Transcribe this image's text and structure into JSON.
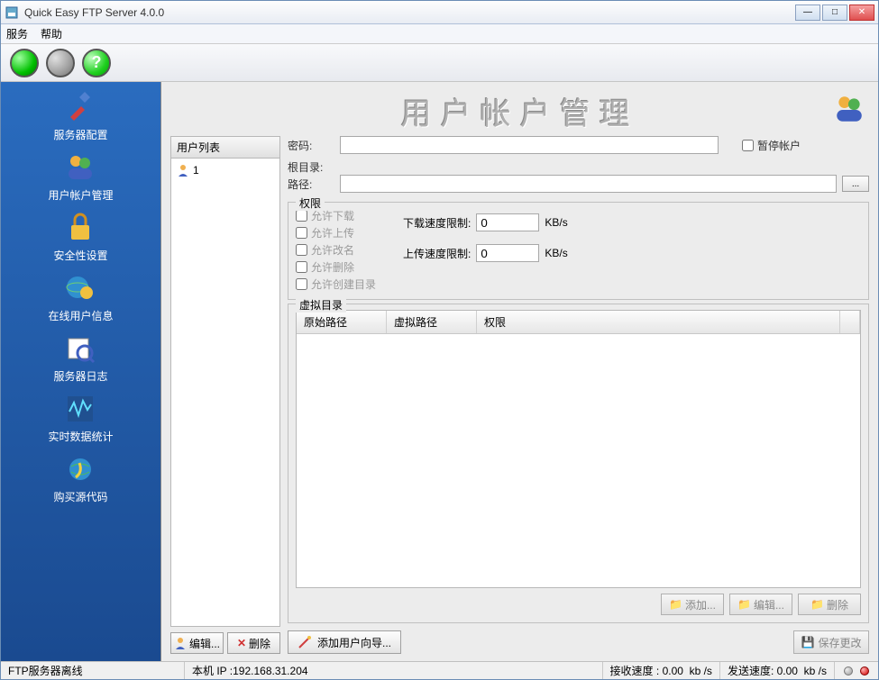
{
  "window": {
    "title": "Quick Easy FTP Server 4.0.0"
  },
  "menu": {
    "service": "服务",
    "help": "帮助"
  },
  "sidebar": {
    "items": [
      {
        "label": "服务器配置"
      },
      {
        "label": "用户帐户管理"
      },
      {
        "label": "安全性设置"
      },
      {
        "label": "在线用户信息"
      },
      {
        "label": "服务器日志"
      },
      {
        "label": "实时数据统计"
      },
      {
        "label": "购买源代码"
      }
    ]
  },
  "page": {
    "title": "用户帐户管理"
  },
  "user_list": {
    "header": "用户列表",
    "users": [
      {
        "name": "1"
      }
    ],
    "edit_btn": "编辑...",
    "delete_btn": "删除"
  },
  "form": {
    "password_label": "密码:",
    "password_value": "",
    "suspend_label": "暂停帐户",
    "rootdir_label": "根目录:",
    "path_label": "路径:",
    "path_value": "",
    "browse_btn": "...",
    "perm_legend": "权限",
    "perms": {
      "download": "允许下载",
      "upload": "允许上传",
      "rename": "允许改名",
      "delete": "允许删除",
      "mkdir": "允许创建目录"
    },
    "dl_speed_label": "下载速度限制:",
    "dl_speed_value": "0",
    "ul_speed_label": "上传速度限制:",
    "ul_speed_value": "0",
    "speed_unit": "KB/s",
    "vdir_legend": "虚拟目录",
    "vdir_cols": {
      "orig": "原始路径",
      "virt": "虚拟路径",
      "perm": "权限"
    },
    "vdir_btns": {
      "add": "添加...",
      "edit": "编辑...",
      "del": "删除"
    },
    "wizard_btn": "添加用户向导...",
    "save_btn": "保存更改"
  },
  "status": {
    "server_state": "FTP服务器离线",
    "ip_label": "本机 IP :",
    "ip_value": "192.168.31.204",
    "rx_label": "接收速度 :",
    "rx_value": "0.00",
    "tx_label": "发送速度:",
    "tx_value": "0.00",
    "unit": "kb /s"
  }
}
